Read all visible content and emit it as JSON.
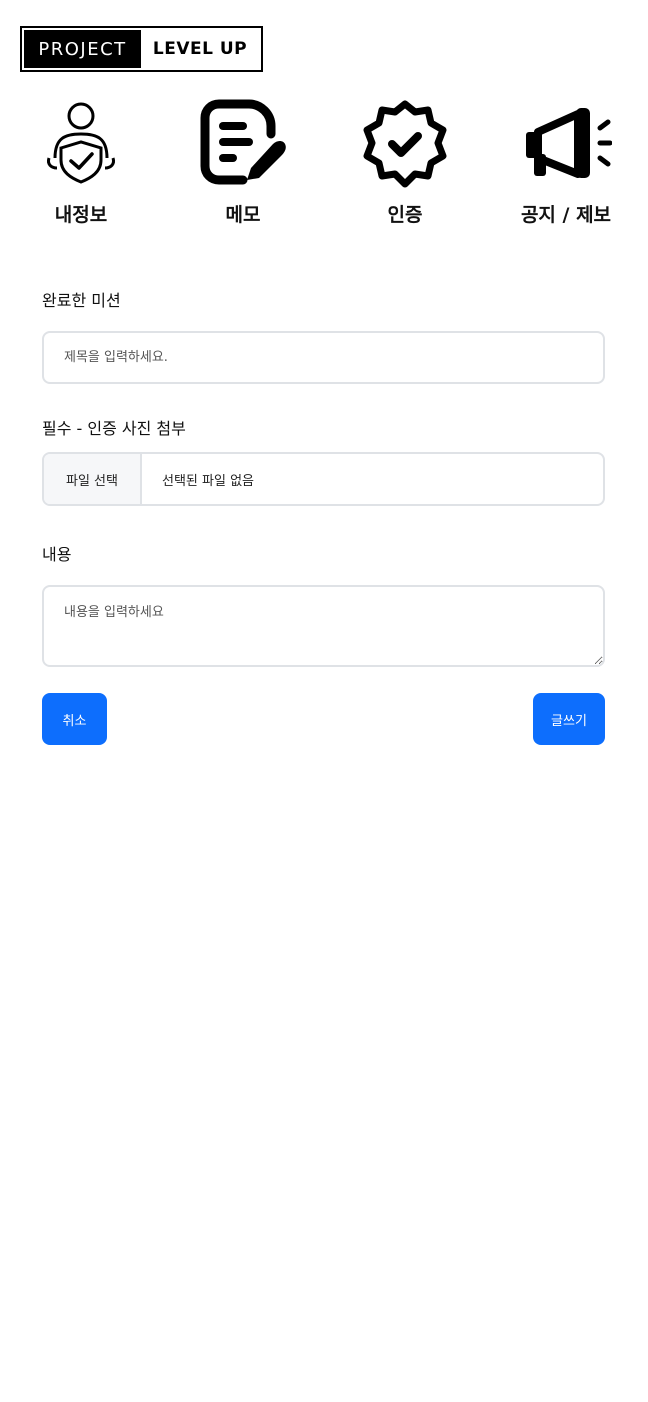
{
  "logo": {
    "left": "PROJECT",
    "right": "LEVEL UP"
  },
  "nav": {
    "items": [
      {
        "label": "내정보",
        "icon": "user-shield-icon"
      },
      {
        "label": "메모",
        "icon": "memo-pencil-icon"
      },
      {
        "label": "인증",
        "icon": "verified-badge-icon"
      },
      {
        "label": "공지 / 제보",
        "icon": "megaphone-icon"
      }
    ]
  },
  "form": {
    "section_title": "완료한 미션",
    "title_placeholder": "제목을 입력하세요.",
    "file_label": "필수 - 인증 사진 첨부",
    "file_button": "파일 선택",
    "file_status": "선택된 파일 없음",
    "content_label": "내용",
    "content_placeholder": "내용을 입력하세요",
    "cancel_label": "취소",
    "submit_label": "글쓰기"
  },
  "colors": {
    "primary": "#0d6efd",
    "border": "#dfe2e6",
    "logo_bg": "#000000"
  }
}
